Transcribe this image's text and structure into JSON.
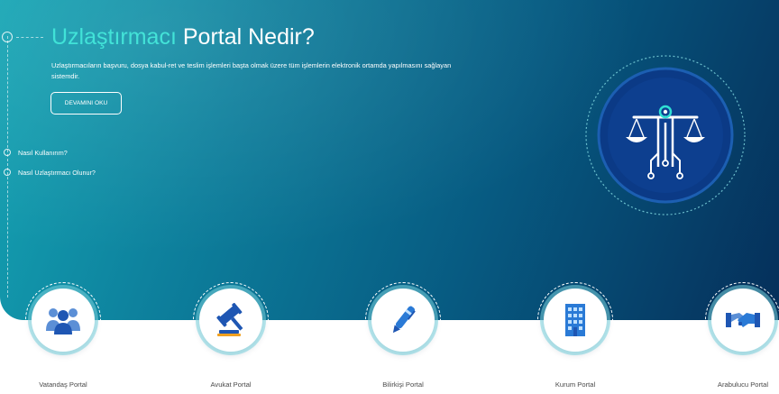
{
  "hero": {
    "title_part1": "Uzlaştırmacı",
    "title_part2": "Portal Nedir?",
    "description": "Uzlaştırmacıların başvuru, dosya kabul-ret ve teslim işlemleri başta olmak üzere tüm işlemlerin elektronik ortamda yapılmasını sağlayan sistemdir.",
    "read_more_label": "DEVAMINI OKU",
    "links": [
      {
        "label": "Nasıl Kullanırım?"
      },
      {
        "label": "Nasıl Uzlaştırmacı Olunur?"
      }
    ],
    "emblem_icon": "scales-of-justice-circuit-icon"
  },
  "portals": [
    {
      "label": "Vatandaş Portal",
      "icon": "citizens-group-icon"
    },
    {
      "label": "Avukat Portal",
      "icon": "gavel-icon"
    },
    {
      "label": "Bilirkişi Portal",
      "icon": "pen-icon"
    },
    {
      "label": "Kurum Portal",
      "icon": "building-icon"
    },
    {
      "label": "Arabulucu Portal",
      "icon": "handshake-icon"
    }
  ],
  "colors": {
    "hero_start": "#15a5b4",
    "hero_end": "#052f5a",
    "accent": "#2fe0d4",
    "icon_blue": "#1e6fc8",
    "emblem_blue": "#0d3f8f"
  }
}
